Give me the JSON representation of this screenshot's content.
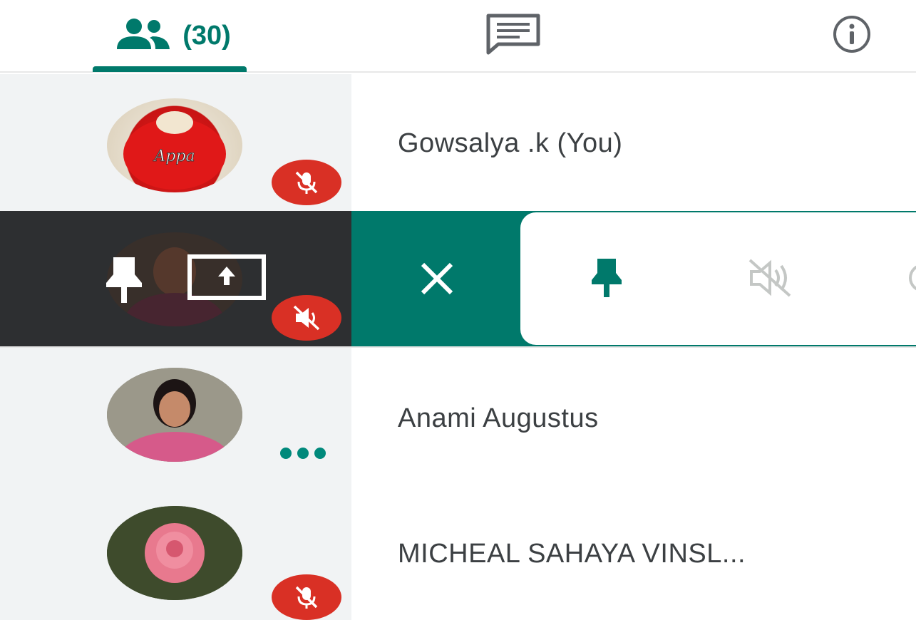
{
  "tabs": {
    "people_count": "(30)",
    "people_icon": "people-icon",
    "chat_icon": "chat-icon",
    "info_icon": "info-icon",
    "accent": "#00796b"
  },
  "participants": [
    {
      "name": "Gowsalya .k (You)",
      "avatar_text": "Appa",
      "status": "muted"
    },
    {
      "name": "",
      "status": "muted",
      "selected": true
    },
    {
      "name": "Anami Augustus",
      "status": "speaking"
    },
    {
      "name": "MICHEAL SAHAYA VINSL...",
      "status": "muted"
    }
  ],
  "row_actions": {
    "icons": [
      "pin-icon",
      "present-screen-icon"
    ],
    "menu": [
      "close-icon",
      "pin-icon",
      "mute-icon"
    ]
  },
  "colors": {
    "mute_badge": "#d93025",
    "selected_bg": "#2d2f31",
    "panel_bg": "#f1f3f4"
  }
}
